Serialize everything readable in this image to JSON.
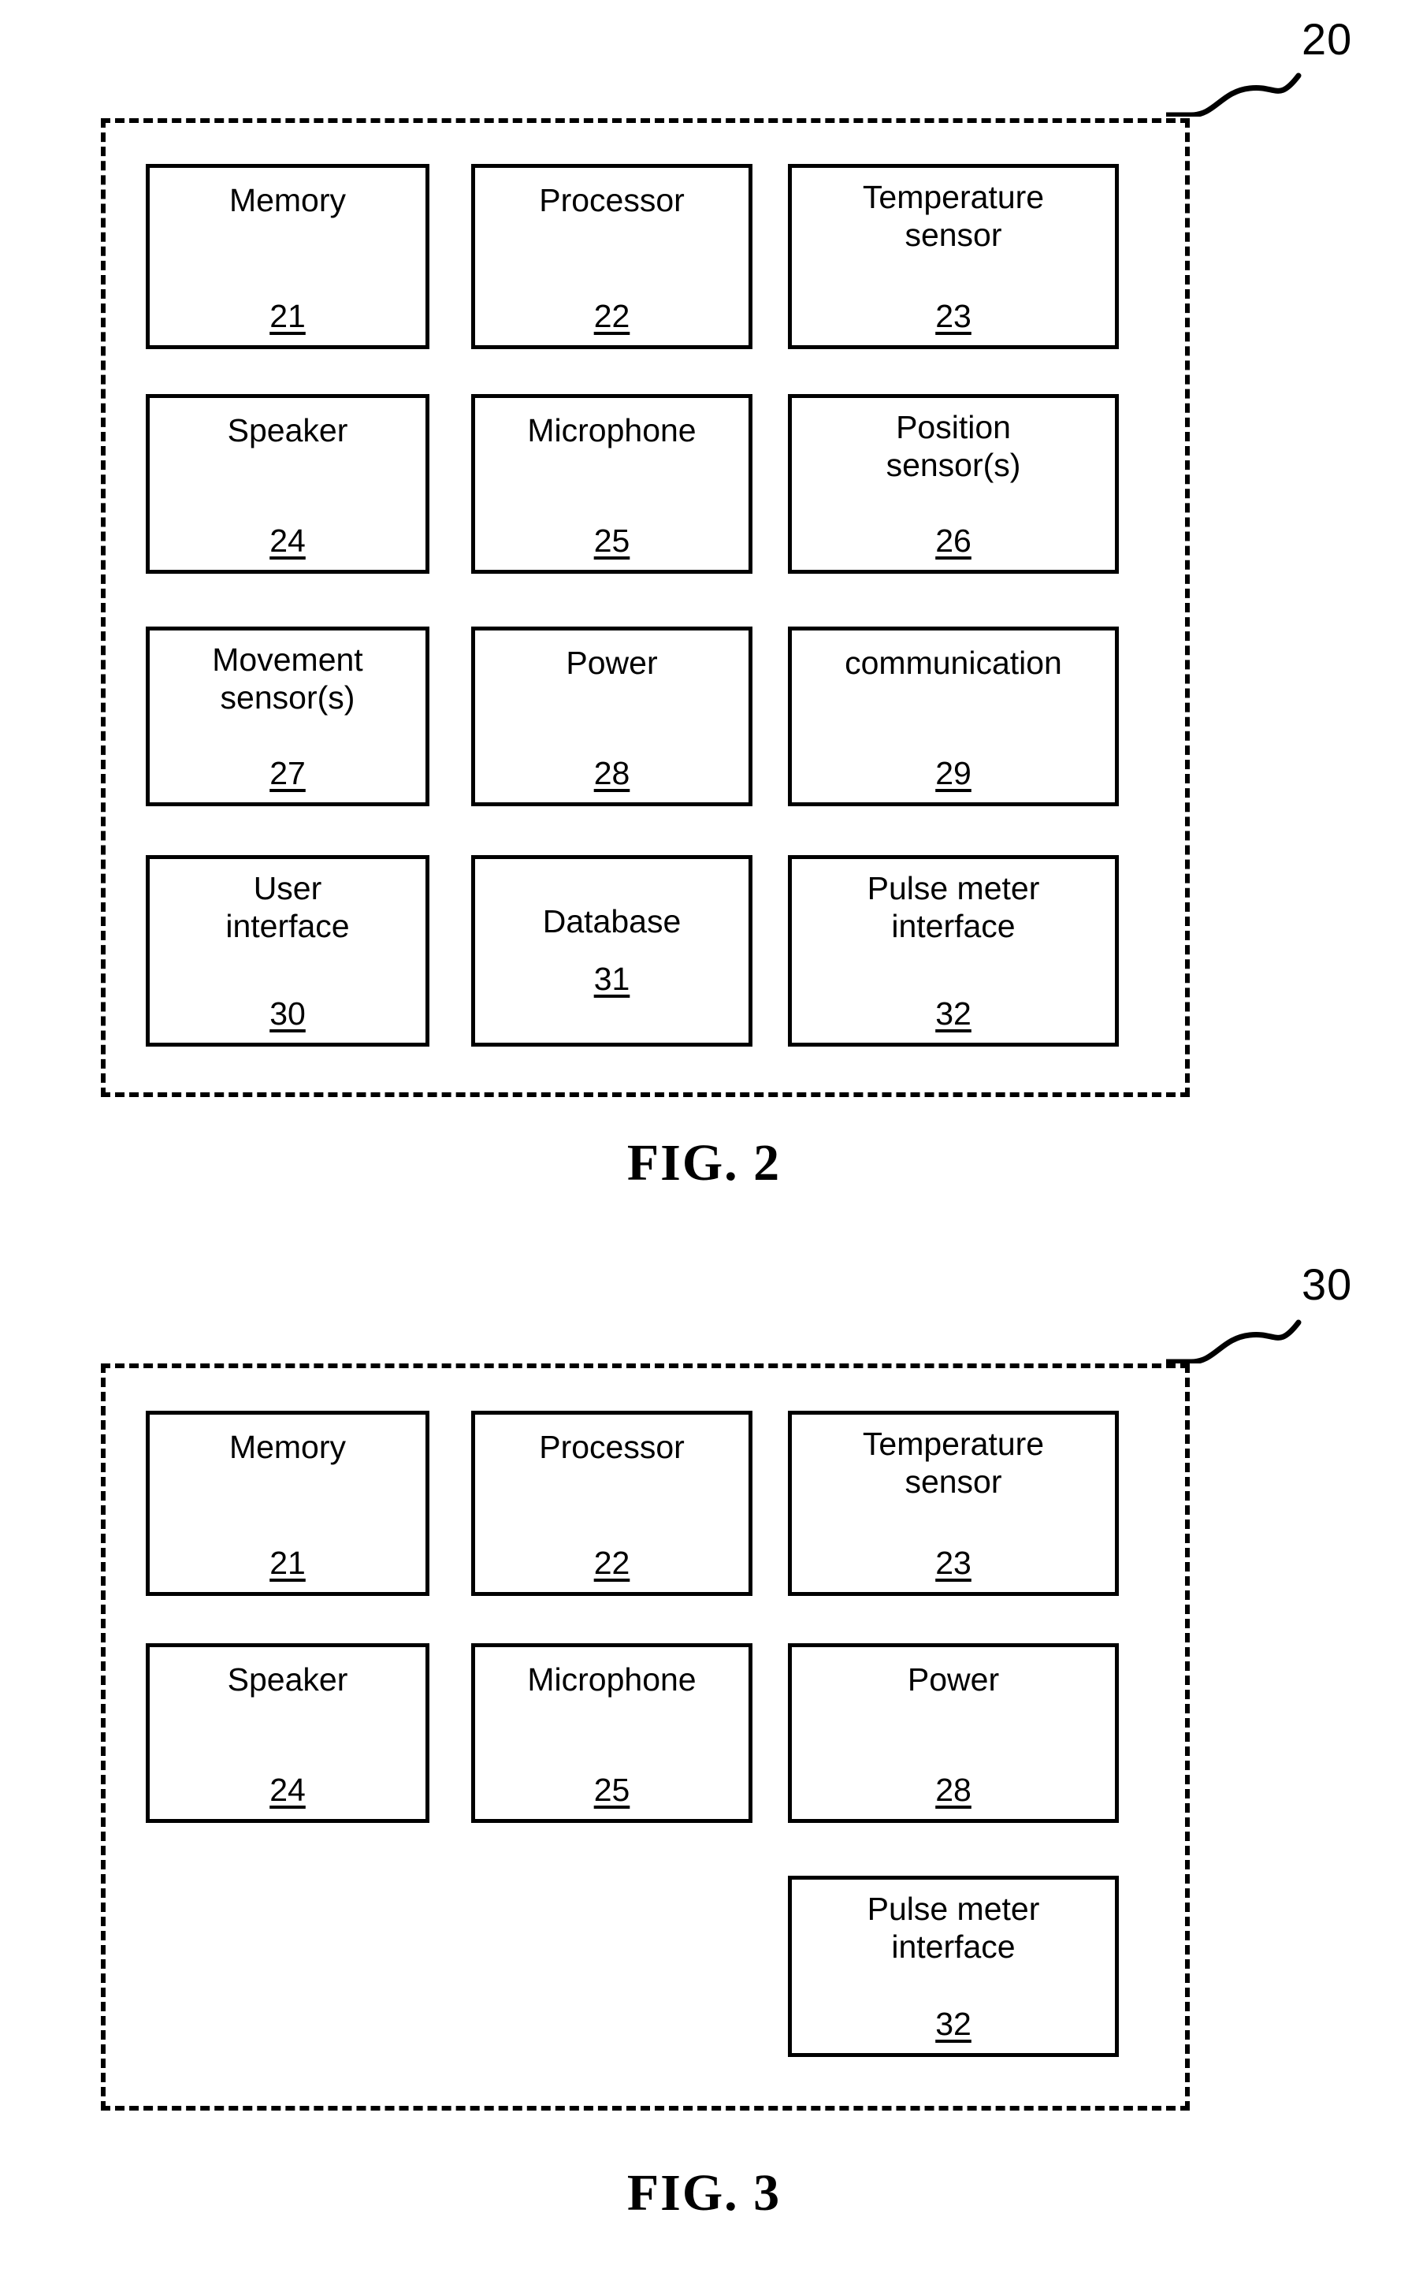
{
  "document": {
    "type": "patent-drawing-sheet",
    "figure_count": 2
  },
  "figures": [
    {
      "id": "fig2",
      "caption": "FIG. 2",
      "reference_numeral": "20",
      "enclosure_style": "dashed",
      "blocks": [
        {
          "label": "Memory",
          "ref": "21",
          "row": 1,
          "col": 1
        },
        {
          "label": "Processor",
          "ref": "22",
          "row": 1,
          "col": 2
        },
        {
          "label": "Temperature\nsensor",
          "ref": "23",
          "row": 1,
          "col": 3
        },
        {
          "label": "Speaker",
          "ref": "24",
          "row": 2,
          "col": 1
        },
        {
          "label": "Microphone",
          "ref": "25",
          "row": 2,
          "col": 2
        },
        {
          "label": "Position\nsensor(s)",
          "ref": "26",
          "row": 2,
          "col": 3
        },
        {
          "label": "Movement\nsensor(s)",
          "ref": "27",
          "row": 3,
          "col": 1
        },
        {
          "label": "Power",
          "ref": "28",
          "row": 3,
          "col": 2
        },
        {
          "label": "communication",
          "ref": "29",
          "row": 3,
          "col": 3
        },
        {
          "label": "User\ninterface",
          "ref": "30",
          "row": 4,
          "col": 1
        },
        {
          "label": "Database",
          "ref": "31",
          "row": 4,
          "col": 2
        },
        {
          "label": "Pulse meter\ninterface",
          "ref": "32",
          "row": 4,
          "col": 3
        }
      ]
    },
    {
      "id": "fig3",
      "caption": "FIG. 3",
      "reference_numeral": "30",
      "enclosure_style": "dashed",
      "blocks": [
        {
          "label": "Memory",
          "ref": "21",
          "row": 1,
          "col": 1
        },
        {
          "label": "Processor",
          "ref": "22",
          "row": 1,
          "col": 2
        },
        {
          "label": "Temperature\nsensor",
          "ref": "23",
          "row": 1,
          "col": 3
        },
        {
          "label": "Speaker",
          "ref": "24",
          "row": 2,
          "col": 1
        },
        {
          "label": "Microphone",
          "ref": "25",
          "row": 2,
          "col": 2
        },
        {
          "label": "Power",
          "ref": "28",
          "row": 2,
          "col": 3
        },
        {
          "label": "Pulse meter\ninterface",
          "ref": "32",
          "row": 3,
          "col": 3
        }
      ]
    }
  ],
  "colors": {
    "ink": "#000000",
    "paper": "#ffffff"
  }
}
